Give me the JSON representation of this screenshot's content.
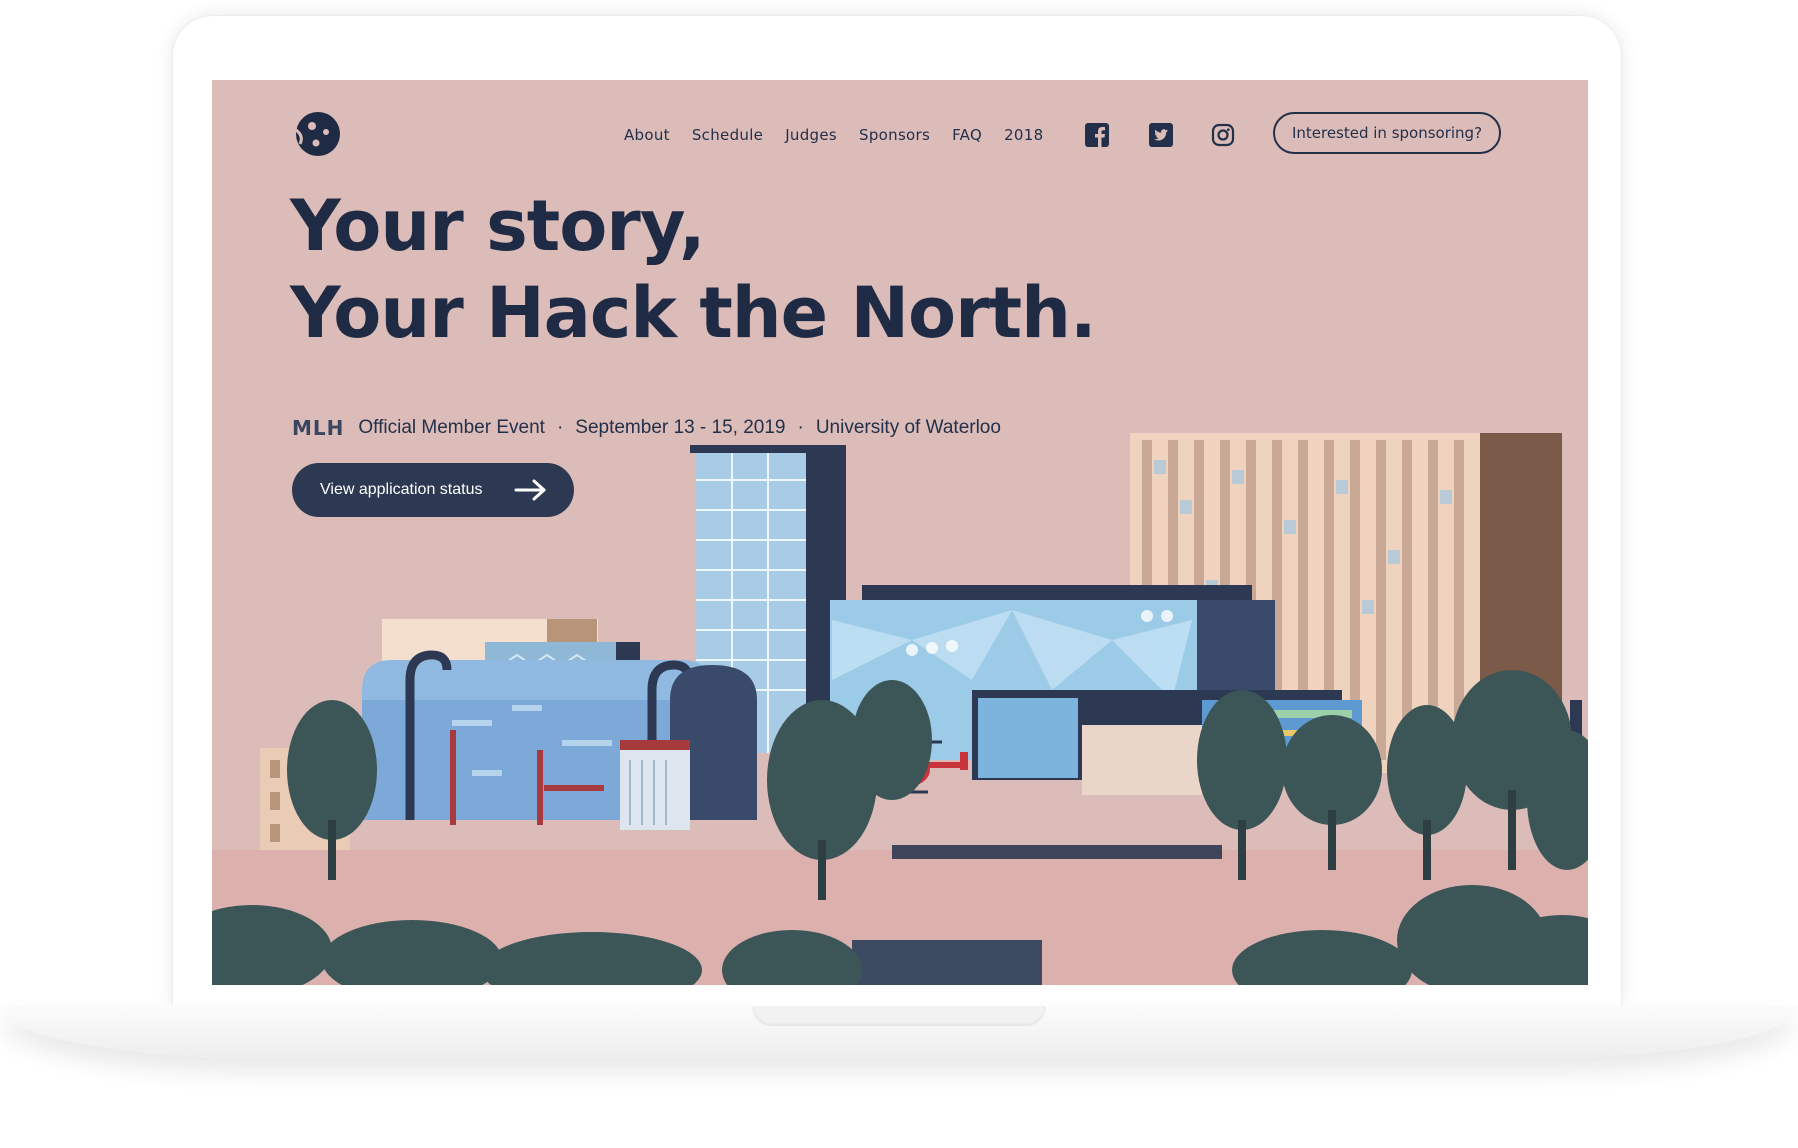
{
  "nav": {
    "links": [
      "About",
      "Schedule",
      "Judges",
      "Sponsors",
      "FAQ",
      "2018"
    ],
    "social_icons": [
      "facebook-icon",
      "twitter-icon",
      "instagram-icon"
    ],
    "sponsor_button": "Interested in sponsoring?"
  },
  "hero": {
    "line1": "Your story,",
    "line2": "Your Hack the North.",
    "mlh_logo_text": "MLH",
    "event_label": "Official Member Event",
    "separator": "·",
    "dates": "September 13 - 15, 2019",
    "location": "University of Waterloo",
    "cta_label": "View application status"
  },
  "colors": {
    "background": "#dcbcb8",
    "navy": "#23304a",
    "button": "#2d3852",
    "tree": "#3c5557",
    "glass": "#8fc3e6",
    "helicopter": "#c7343c"
  },
  "illustration": "campus-skyline-illustration"
}
